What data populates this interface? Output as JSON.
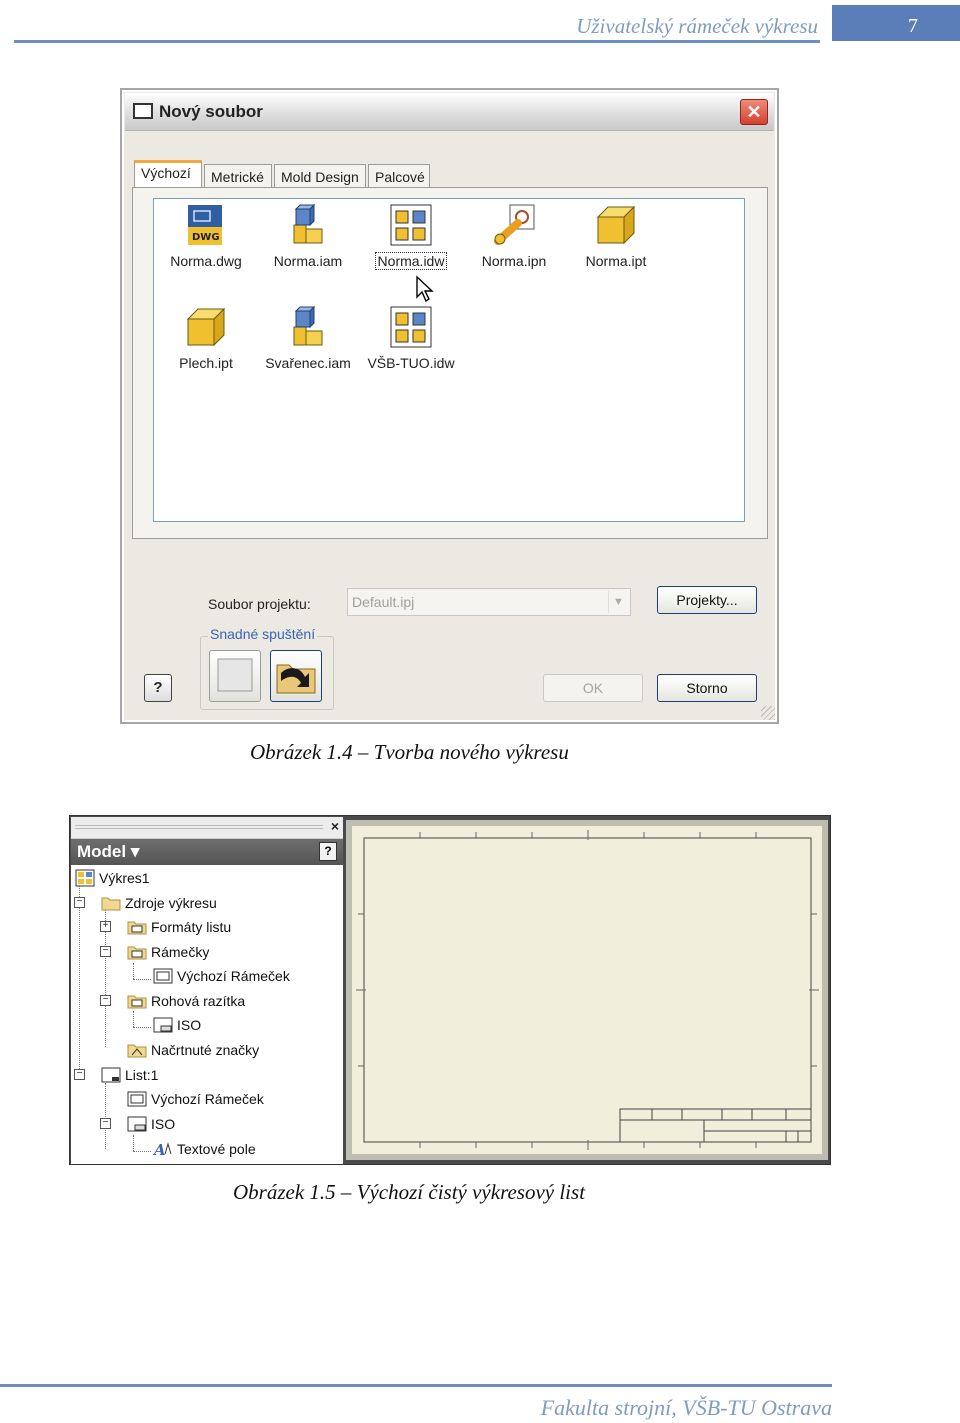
{
  "header": {
    "title": "Uživatelský rámeček výkresu",
    "page_number": "7"
  },
  "footer": {
    "text": "Fakulta strojní, VŠB-TU Ostrava"
  },
  "captions": {
    "fig1": "Obrázek 1.4 – Tvorba nového výkresu",
    "fig2": "Obrázek 1.5 – Výchozí čistý výkresový list"
  },
  "dialog": {
    "title": "Nový soubor",
    "close": "✕",
    "tabs": [
      "Výchozí",
      "Metrické",
      "Mold Design",
      "Palcové"
    ],
    "active_tab": "Výchozí",
    "files": [
      {
        "name": "Norma.dwg",
        "icon": "dwg-file-icon"
      },
      {
        "name": "Norma.iam",
        "icon": "assembly-icon"
      },
      {
        "name": "Norma.idw",
        "icon": "drawing-icon",
        "selected": true
      },
      {
        "name": "Norma.ipn",
        "icon": "presentation-icon"
      },
      {
        "name": "Norma.ipt",
        "icon": "part-icon"
      },
      {
        "name": "Plech.ipt",
        "icon": "part-icon"
      },
      {
        "name": "Svařenec.iam",
        "icon": "assembly-icon"
      },
      {
        "name": "VŠB-TUO.idw",
        "icon": "drawing-icon"
      }
    ],
    "project_label": "Soubor projektu:",
    "project_value": "Default.ipj",
    "projects_button": "Projekty...",
    "quick_start_label": "Snadné spuštění",
    "ok_button": "OK",
    "cancel_button": "Storno",
    "help": "?"
  },
  "browser": {
    "close": "×",
    "title": "Model ▾",
    "help": "?",
    "tree": [
      {
        "label": "Výkres1",
        "level": 0,
        "icon": "drawing-doc-icon"
      },
      {
        "label": "Zdroje výkresu",
        "level": 1,
        "icon": "folder-icon",
        "toggle": "−"
      },
      {
        "label": "Formáty listu",
        "level": 2,
        "icon": "folder-icon",
        "toggle": "+"
      },
      {
        "label": "Rámečky",
        "level": 2,
        "icon": "folder-icon",
        "toggle": "−"
      },
      {
        "label": "Výchozí Rámeček",
        "level": 3,
        "icon": "border-icon"
      },
      {
        "label": "Rohová razítka",
        "level": 2,
        "icon": "folder-icon",
        "toggle": "−"
      },
      {
        "label": "ISO",
        "level": 3,
        "icon": "title-block-icon"
      },
      {
        "label": "Načrtnuté značky",
        "level": 2,
        "icon": "sketch-symbol-icon"
      },
      {
        "label": "List:1",
        "level": 1,
        "icon": "sheet-icon",
        "toggle": "−"
      },
      {
        "label": "Výchozí Rámeček",
        "level": 2,
        "icon": "border-icon"
      },
      {
        "label": "ISO",
        "level": 2,
        "icon": "title-block-icon",
        "toggle": "−"
      },
      {
        "label": "Textové pole",
        "level": 3,
        "icon": "text-field-icon"
      }
    ]
  },
  "colors": {
    "accent": "#5a7fb8",
    "header_text": "#7f9cc0",
    "sheet": "#f1eedb"
  }
}
